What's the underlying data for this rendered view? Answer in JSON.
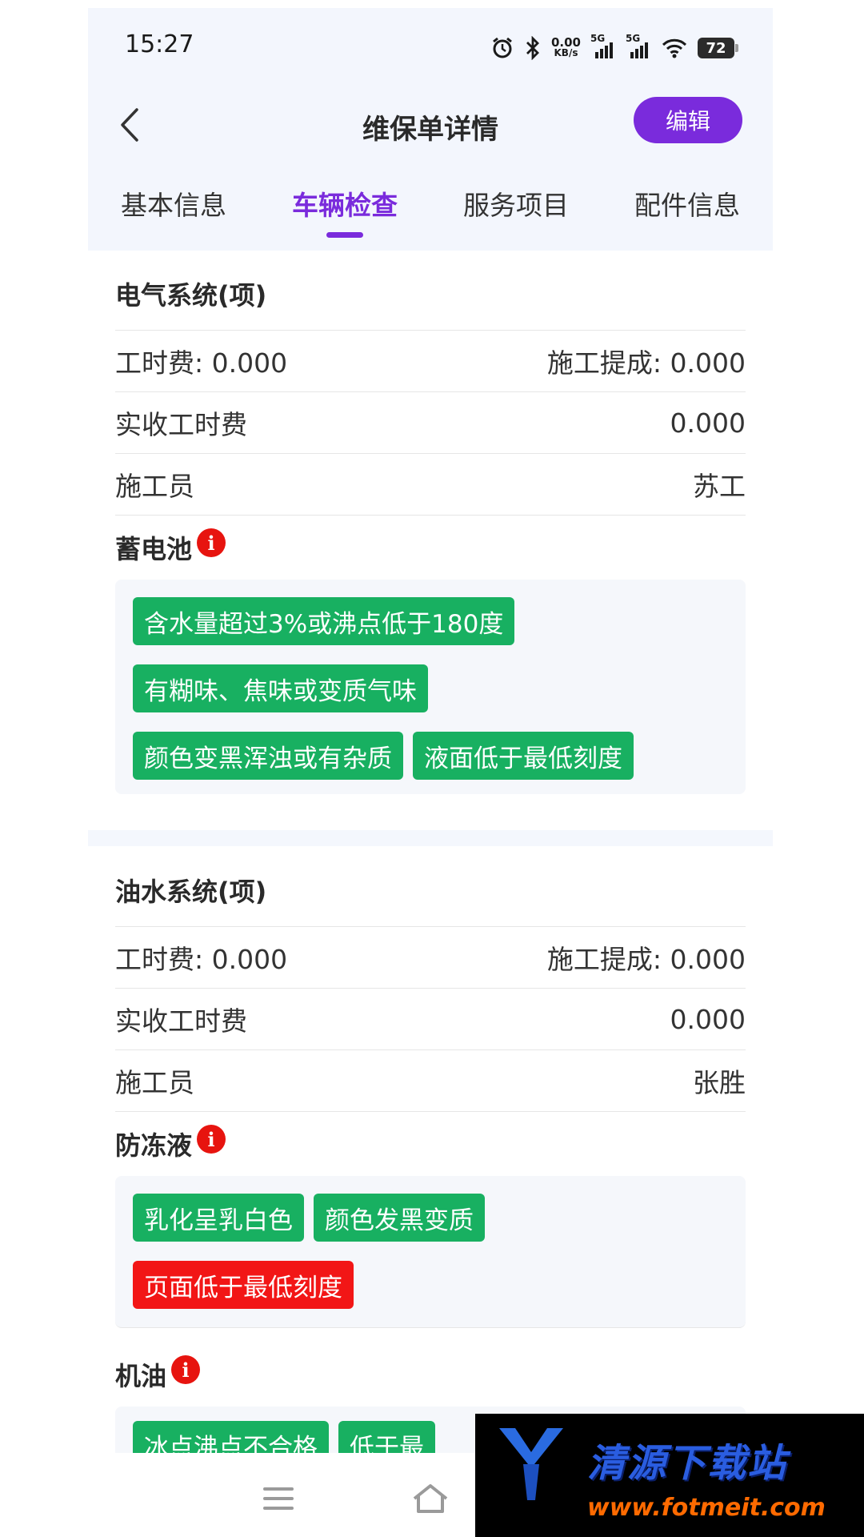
{
  "status_bar": {
    "time": "15:27",
    "net_speed_value": "0.00",
    "net_speed_unit": "KB/s",
    "sim1_label": "5G",
    "sim2_label": "5G",
    "battery": "72",
    "icons": [
      "alarm-icon",
      "bluetooth-icon",
      "signal-icon",
      "wifi-icon",
      "battery-icon"
    ]
  },
  "header": {
    "title": "维保单详情",
    "edit_label": "编辑",
    "back_icon": "chevron-left-icon"
  },
  "tabs": [
    {
      "label": "基本信息",
      "active": false
    },
    {
      "label": "车辆检查",
      "active": true
    },
    {
      "label": "服务项目",
      "active": false
    },
    {
      "label": "配件信息",
      "active": false
    }
  ],
  "sections": [
    {
      "title": "电气系统(项)",
      "labor_fee": "工时费: 0.000",
      "commission": "施工提成: 0.000",
      "actual_fee_label": "实收工时费",
      "actual_fee_value": "0.000",
      "worker_label": "施工员",
      "worker_value": "苏工",
      "item_title": "蓄电池",
      "tags": [
        {
          "text": "含水量超过3%或沸点低于180度",
          "color": "#18b061"
        },
        {
          "text": "有糊味、焦味或变质气味",
          "color": "#18b061"
        },
        {
          "text": "颜色变黑浑浊或有杂质",
          "color": "#18b061"
        },
        {
          "text": "液面低于最低刻度",
          "color": "#18b061"
        }
      ]
    },
    {
      "title": "油水系统(项)",
      "labor_fee": "工时费: 0.000",
      "commission": "施工提成: 0.000",
      "actual_fee_label": "实收工时费",
      "actual_fee_value": "0.000",
      "worker_label": "施工员",
      "worker_value": "张胜",
      "item_title": "防冻液",
      "tags": [
        {
          "text": "乳化呈乳白色",
          "color": "#18b061"
        },
        {
          "text": "颜色发黑变质",
          "color": "#18b061"
        },
        {
          "text": "页面低于最低刻度",
          "color": "#f21616"
        }
      ],
      "item2_title": "机油",
      "item2_tags": [
        {
          "text": "冰点沸点不合格",
          "color": "#18b061"
        },
        {
          "text": "低于最",
          "color": "#18b061"
        }
      ]
    }
  ],
  "info_icon_glyph": "i",
  "bottom_nav": [
    "menu-icon",
    "home-icon"
  ],
  "watermark": {
    "text": "清源下载站",
    "url": "www.fotmeit.com"
  },
  "colors": {
    "accent": "#7a2bdc",
    "tag_green": "#18b061",
    "tag_red": "#f21616",
    "info_red": "#e7140f",
    "header_bg": "#f3f6fd"
  }
}
